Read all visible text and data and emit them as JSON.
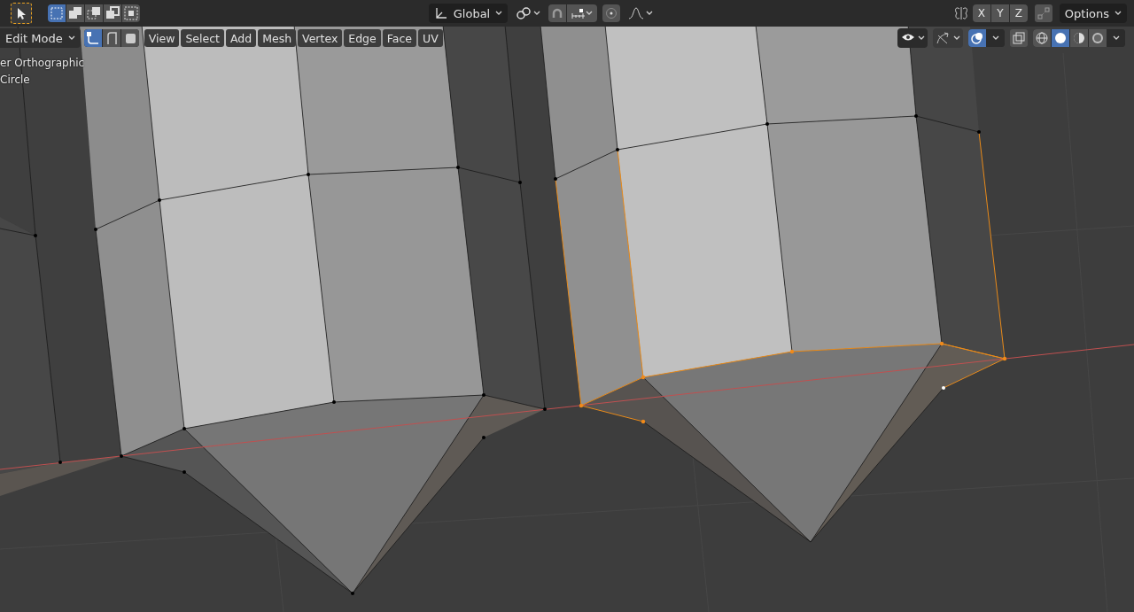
{
  "header": {
    "tool": {
      "selected": true
    },
    "select_modes": [
      {
        "kind": "new",
        "selected": true
      },
      {
        "kind": "extend",
        "selected": false
      },
      {
        "kind": "subtract",
        "selected": false
      },
      {
        "kind": "invert",
        "selected": false
      },
      {
        "kind": "intersect",
        "selected": false
      }
    ],
    "orientation": "Global",
    "snap": {
      "selected": false
    },
    "proportional_editing": {
      "selected": false
    },
    "axes": [
      {
        "label": "X",
        "selected": false
      },
      {
        "label": "Y",
        "selected": false
      },
      {
        "label": "Z",
        "selected": false
      }
    ],
    "options": "Options"
  },
  "viewport_header": {
    "mode": "Edit Mode",
    "element_modes": [
      {
        "kind": "vertex",
        "selected": true
      },
      {
        "kind": "edge",
        "selected": false
      },
      {
        "kind": "face",
        "selected": false
      }
    ],
    "menus": [
      "View",
      "Select",
      "Add",
      "Mesh",
      "Vertex",
      "Edge",
      "Face",
      "UV"
    ],
    "overlays": {
      "selected": true
    },
    "xray": {
      "selected": false
    },
    "shading_modes": [
      {
        "kind": "wireframe",
        "selected": false
      },
      {
        "kind": "solid",
        "selected": true
      },
      {
        "kind": "material",
        "selected": false
      },
      {
        "kind": "rendered",
        "selected": false
      }
    ]
  },
  "view_info": [
    "er Orthographic",
    "Circle"
  ]
}
